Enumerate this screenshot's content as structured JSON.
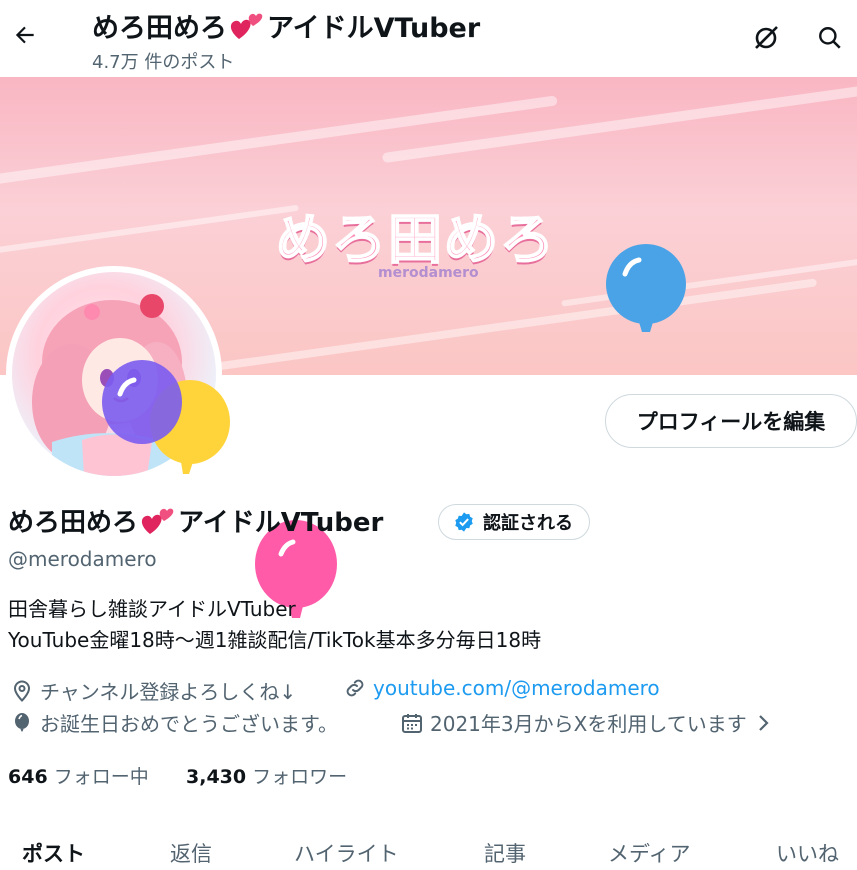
{
  "header": {
    "title_pre": "めろ田めろ",
    "title_post": "アイドルVTuber",
    "post_count": "4.7万 件のポスト"
  },
  "banner": {
    "logo_text": "めろ田めろ",
    "logo_sub": "merodamero"
  },
  "profile": {
    "edit_button": "プロフィールを編集",
    "name_pre": "めろ田めろ",
    "name_post": "アイドルVTuber",
    "verified_label": "認証される",
    "handle": "@merodamero",
    "bio_line1": "田舎暮らし雑談アイドルVTuber",
    "bio_line2": "YouTube金曜18時〜週1雑談配信/TikTok基本多分毎日18時",
    "location": "チャンネル登録よろしくね↓",
    "website": "youtube.com/@merodamero",
    "birthday": "お誕生日おめでとうございます。",
    "joined": "2021年3月からXを利用しています",
    "following_count": "646",
    "following_label": "フォロー中",
    "followers_count": "3,430",
    "followers_label": "フォロワー"
  },
  "tabs": [
    "ポスト",
    "返信",
    "ハイライト",
    "記事",
    "メディア",
    "いいね"
  ],
  "colors": {
    "accent": "#1d9bf0",
    "verified": "#1d9bf0",
    "banner_pink": "#f9b6c3",
    "balloon_blue": "#4aa3e6",
    "balloon_purple": "#7b5cf0",
    "balloon_yellow": "#ffd43b",
    "balloon_pink": "#ff5ba8"
  },
  "icons": {
    "back": "arrow-left-icon",
    "grok": "grok-icon",
    "search": "search-icon",
    "location": "location-pin-icon",
    "link": "link-icon",
    "birthday": "balloon-icon",
    "calendar": "calendar-icon",
    "heart": "two-hearts-emoji"
  }
}
